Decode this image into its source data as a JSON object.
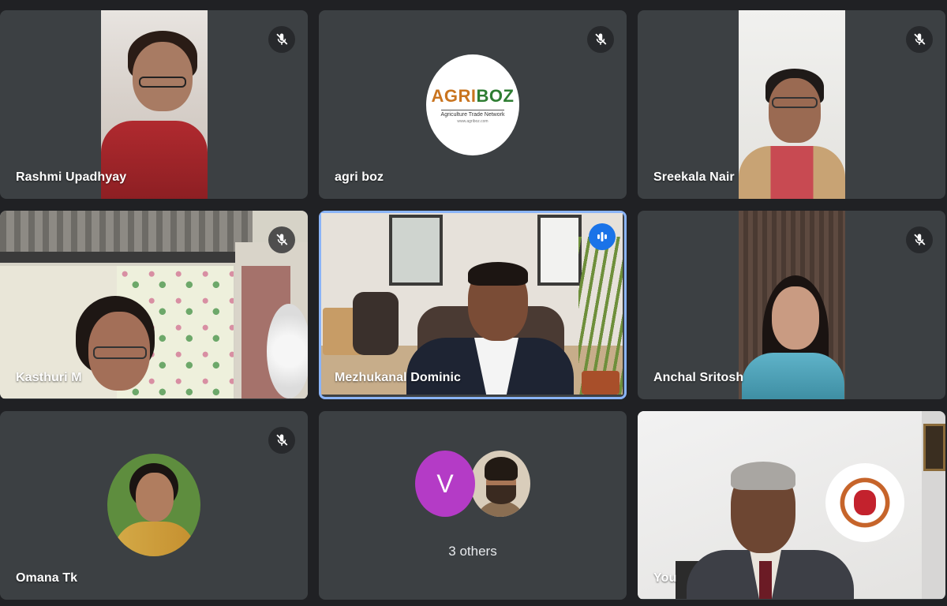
{
  "participants": [
    {
      "name": "Rashmi Upadhyay",
      "muted": true
    },
    {
      "name": "agri boz",
      "muted": true,
      "logo": {
        "main_left": "AGRI",
        "main_right": "BOZ",
        "tagline": "Agriculture Trade Network",
        "url": "www.agriboz.com"
      }
    },
    {
      "name": "Sreekala Nair",
      "muted": true
    },
    {
      "name": "Kasthuri M",
      "muted": true
    },
    {
      "name": "Mezhukanal Dominic",
      "muted": false,
      "speaking": true
    },
    {
      "name": "Anchal Sritosh",
      "muted": true
    },
    {
      "name": "Omana Tk",
      "muted": true
    },
    {
      "name": "",
      "group": {
        "avatar_letter": "V",
        "label": "3 others"
      }
    },
    {
      "name": "You",
      "muted": false
    }
  ],
  "colors": {
    "background": "#202124",
    "tile": "#3c4043",
    "active_outline": "#8ab4f8",
    "speaking_indicator": "#1a73e8",
    "avatar_v": "#b43bc6",
    "logo_agri": "#c9741f",
    "logo_boz": "#2e7d32"
  },
  "icons": {
    "muted": "mic-off-icon",
    "speaking": "audio-level-icon"
  }
}
